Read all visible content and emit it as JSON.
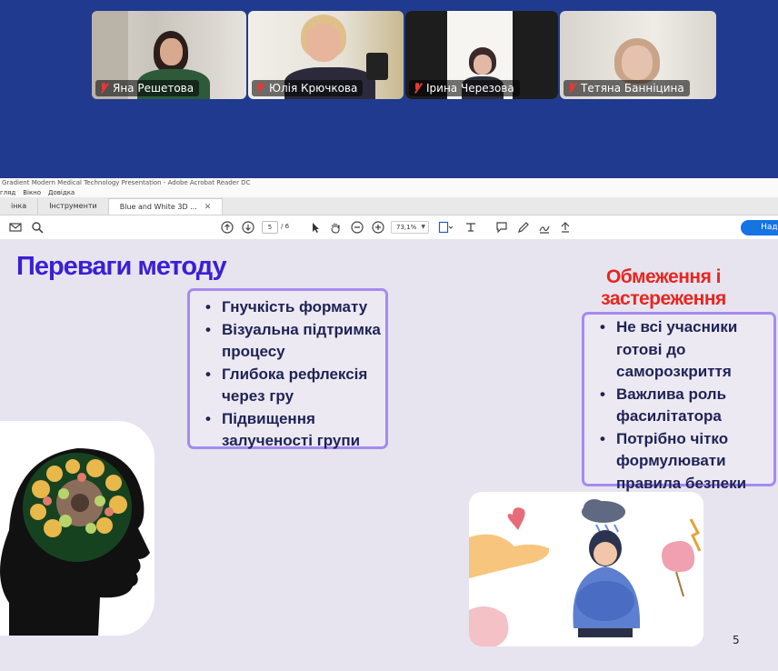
{
  "participants": [
    {
      "name": "Яна Решетова",
      "muted": true
    },
    {
      "name": "Юлія Крючкова",
      "muted": true,
      "active": true
    },
    {
      "name": "Ірина Черезова",
      "muted": true
    },
    {
      "name": "Тетяна Банніцина",
      "muted": true
    }
  ],
  "acrobat": {
    "window_title": "Gradient Modern Medical Technology Presentation - Adobe Acrobat Reader DC",
    "menu": [
      "гляд",
      "Вікно",
      "Довідка"
    ],
    "tabs": [
      "інка",
      "Інструменти",
      "Blue and White 3D ..."
    ],
    "tab_close": "✕",
    "page_current": "5",
    "page_total": "/ 6",
    "zoom": "73,1%",
    "share_label": "Над"
  },
  "slide": {
    "title": "Переваги методу",
    "advantages": [
      "Гнучкість формату",
      "Візуальна підтримка процесу",
      "Глибока рефлексія через гру",
      "Підвищення залученості групи"
    ],
    "limits_title": "Обмеження і застереження",
    "limits": [
      "Не всі учасники готові до саморозкриття",
      "Важлива роль фасилітатора",
      "Потрібно чітко формулювати правила безпеки"
    ],
    "page_number": "5"
  },
  "icons": [
    "mic-muted-icon",
    "mail-icon",
    "search-icon",
    "page-up-icon",
    "page-down-icon",
    "select-arrow-icon",
    "hand-icon",
    "zoom-out-icon",
    "zoom-in-icon",
    "fit-page-icon",
    "stamp-icon",
    "comment-icon",
    "pen-icon",
    "sign-icon",
    "share-icon"
  ],
  "colors": {
    "title_blue": "#3a1fd6",
    "title_red": "#e8261f",
    "box_border": "#a58bf0",
    "zoom_bg": "#1f3a8f",
    "active_speaker": "#3ddc84"
  }
}
